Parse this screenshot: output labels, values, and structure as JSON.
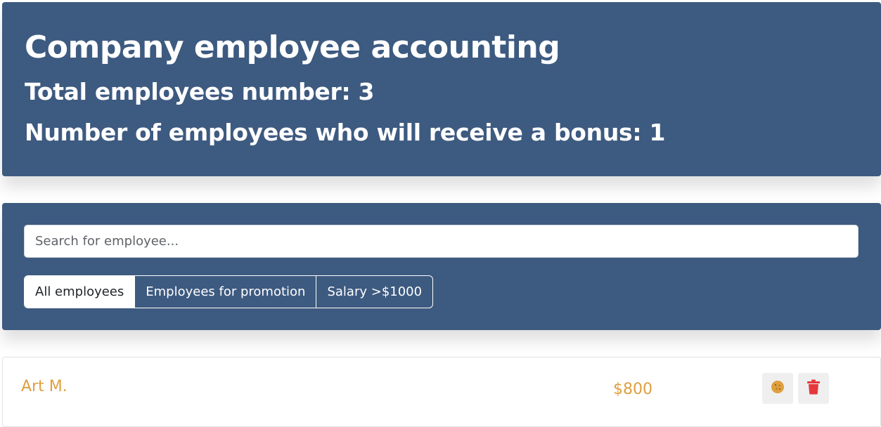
{
  "app_info": {
    "title": "Company employee accounting",
    "total_label": "Total employees number: 3",
    "bonus_label": "Number of employees who will receive a bonus: 1"
  },
  "search": {
    "placeholder": "Search for employee..."
  },
  "filters": [
    {
      "label": "All employees",
      "active": true
    },
    {
      "label": "Employees for promotion",
      "active": false
    },
    {
      "label": "Salary >$1000",
      "active": false
    }
  ],
  "employees": [
    {
      "name": "Art M.",
      "salary": "$800"
    }
  ],
  "icons": {
    "cookie": "cookie-icon",
    "trash": "trash-icon"
  },
  "colors": {
    "panel": "#3d5a80",
    "accent": "#e09f3e",
    "danger": "#e5383b"
  }
}
